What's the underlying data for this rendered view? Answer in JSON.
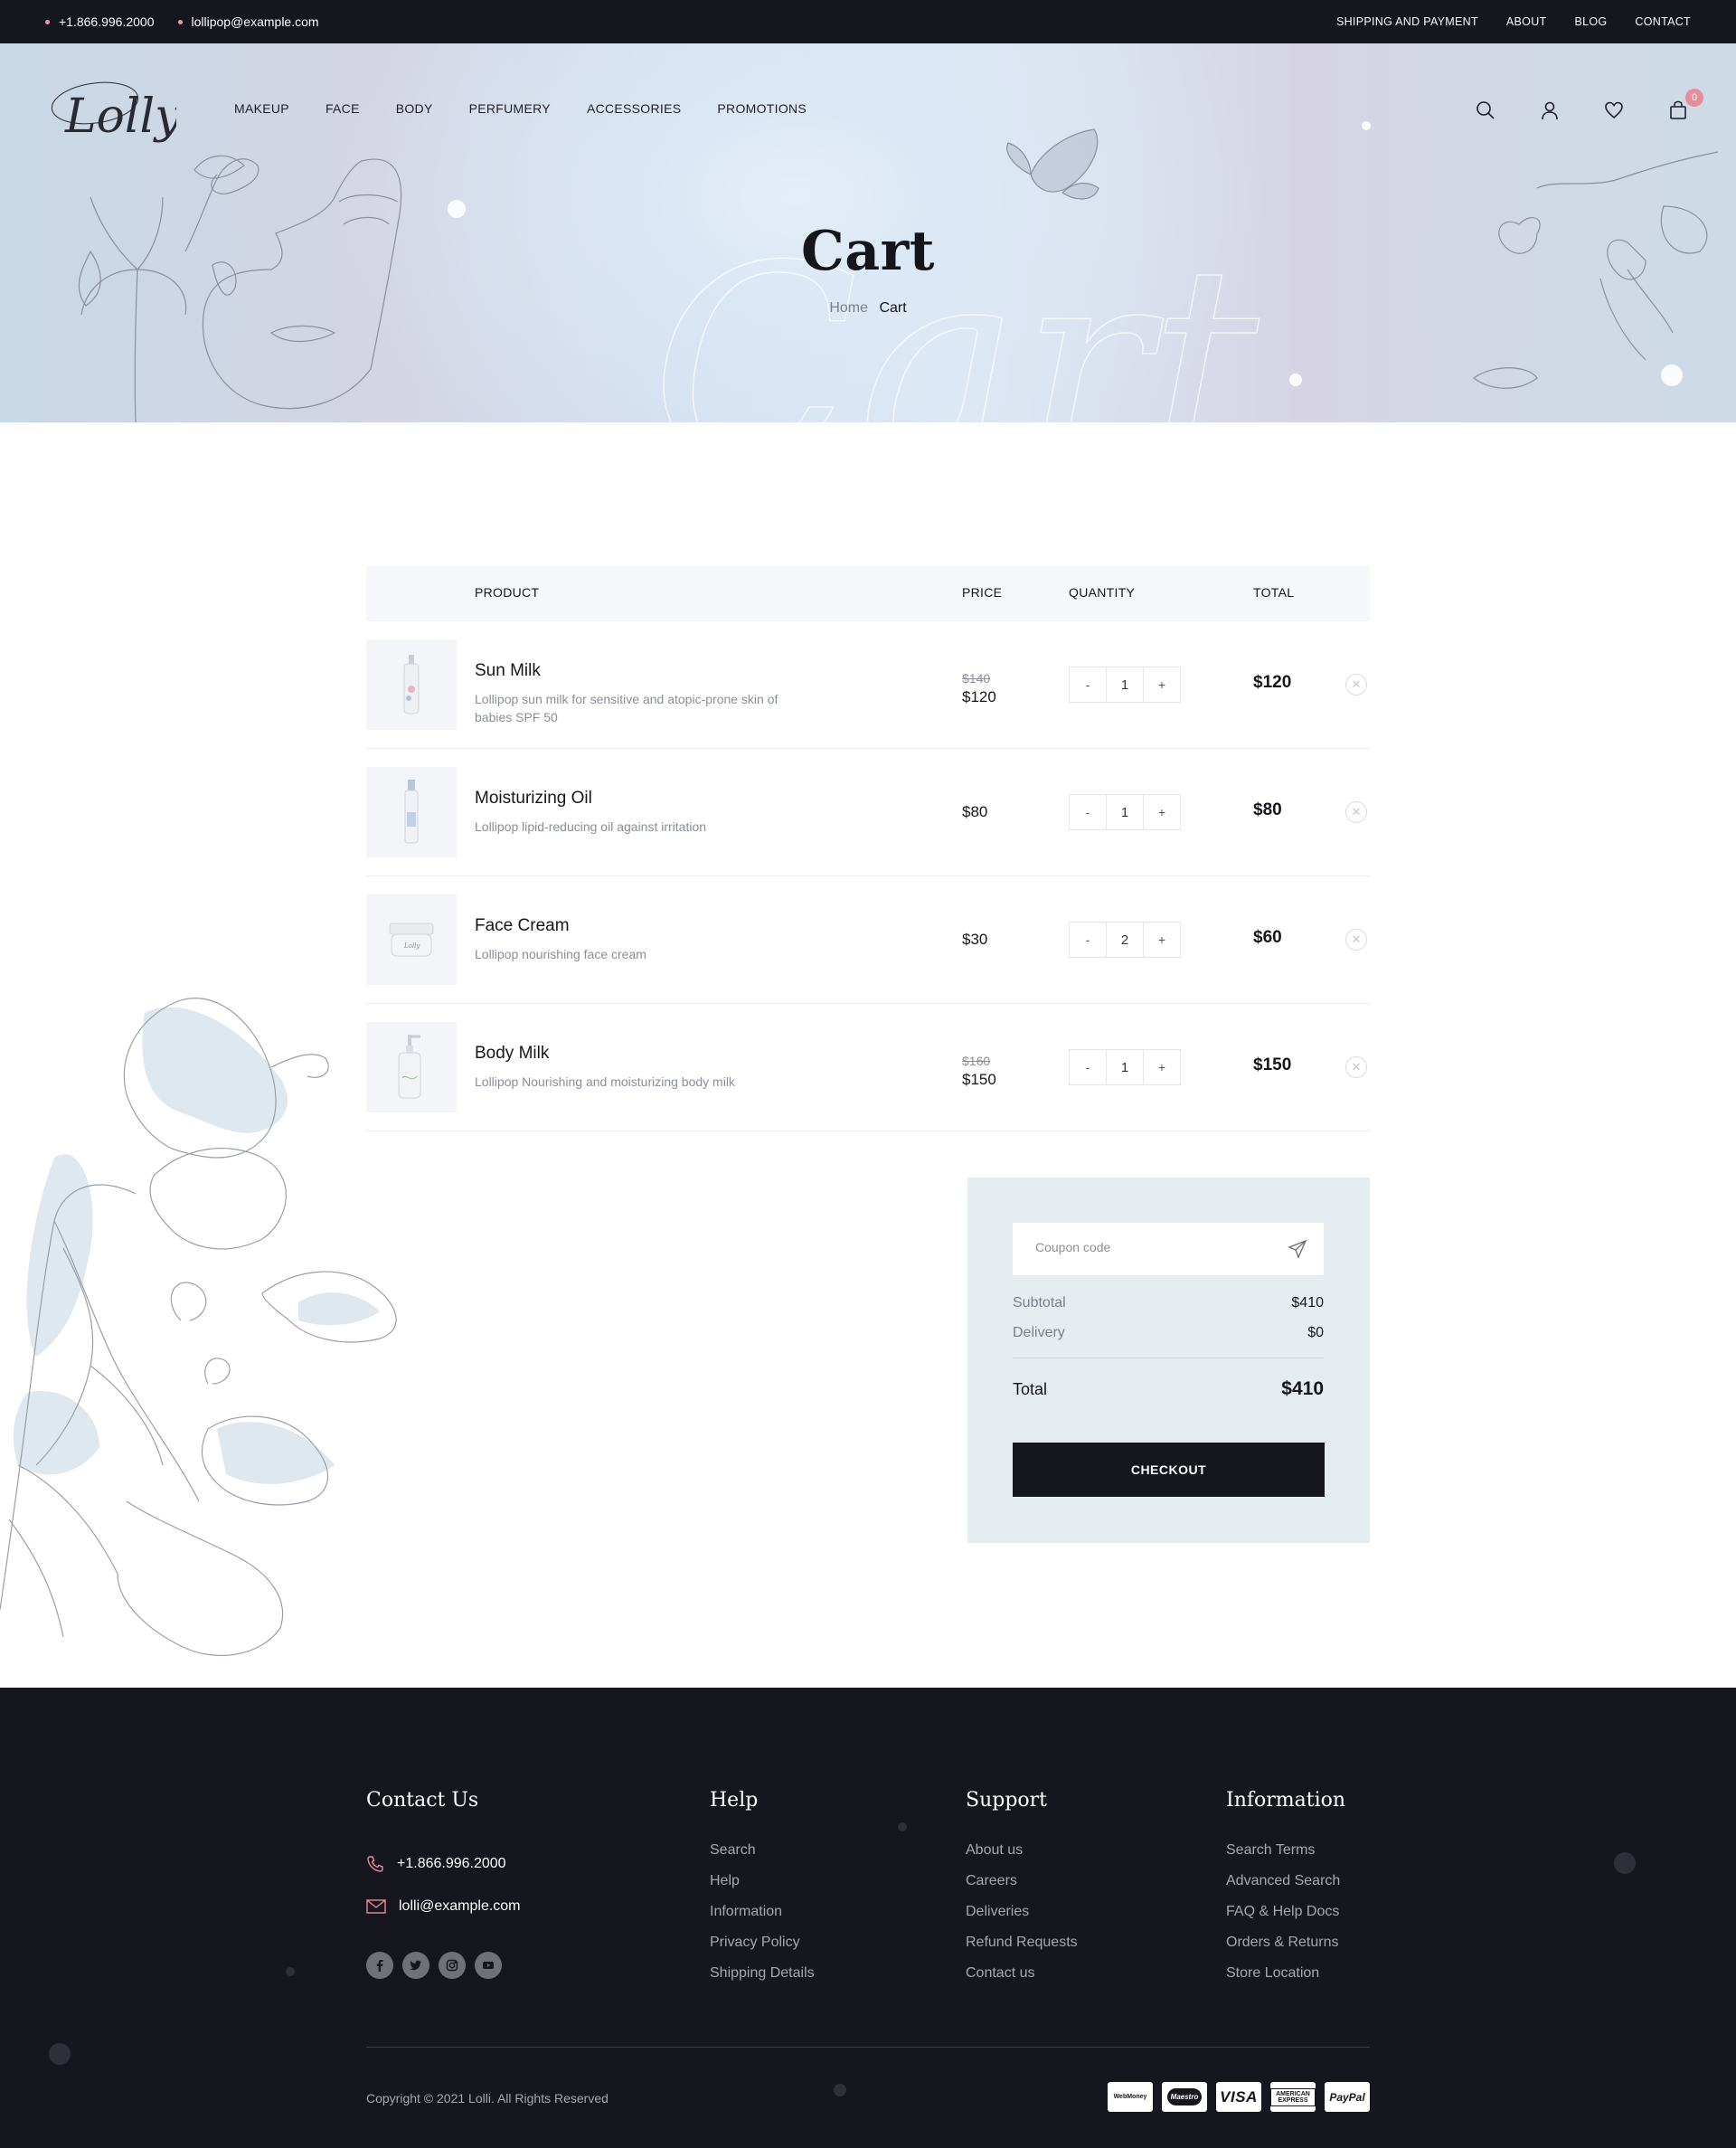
{
  "topbar": {
    "phone": "+1.866.996.2000",
    "email": "lollipop@example.com",
    "links": [
      "SHIPPING AND PAYMENT",
      "ABOUT",
      "BLOG",
      "CONTACT"
    ]
  },
  "header": {
    "logo_text": "Lolly",
    "nav": [
      "MAKEUP",
      "FACE",
      "BODY",
      "PERFUMERY",
      "ACCESSORIES",
      "PROMOTIONS"
    ],
    "icons": [
      "search-icon",
      "user-icon",
      "heart-icon",
      "bag-icon"
    ],
    "cart_count": "0"
  },
  "hero": {
    "title": "Cart",
    "watermark": "Cart",
    "breadcrumb": {
      "home": "Home",
      "current": "Cart"
    }
  },
  "cart": {
    "headers": {
      "product": "PRODUCT",
      "price": "PRICE",
      "quantity": "QUANTITY",
      "total": "TOTAL"
    },
    "items": [
      {
        "name": "Sun Milk",
        "description": "Lollipop sun milk for sensitive and atopic-prone skin of babies SPF 50",
        "old_price": "$140",
        "price": "$120",
        "qty": "1",
        "total": "$120"
      },
      {
        "name": "Moisturizing Oil",
        "description": "Lollipop lipid-reducing oil against irritation",
        "old_price": "",
        "price": "$80",
        "qty": "1",
        "total": "$80"
      },
      {
        "name": "Face Cream",
        "description": "Lollipop nourishing face cream",
        "old_price": "",
        "price": "$30",
        "qty": "2",
        "total": "$60"
      },
      {
        "name": "Body Milk",
        "description": "Lollipop Nourishing and moisturizing body milk",
        "old_price": "$160",
        "price": "$150",
        "qty": "1",
        "total": "$150"
      }
    ],
    "qty_minus": "-",
    "qty_plus": "+"
  },
  "summary": {
    "coupon_placeholder": "Coupon code",
    "subtotal_label": "Subtotal",
    "subtotal_value": "$410",
    "delivery_label": "Delivery",
    "delivery_value": "$0",
    "total_label": "Total",
    "total_value": "$410",
    "checkout_label": "CHECKOUT"
  },
  "footer": {
    "contact": {
      "title": "Contact Us",
      "phone": "+1.866.996.2000",
      "email": "lolli@example.com"
    },
    "help": {
      "title": "Help",
      "items": [
        "Search",
        "Help",
        "Information",
        "Privacy Policy",
        "Shipping Details"
      ]
    },
    "support": {
      "title": "Support",
      "items": [
        "About us",
        "Careers",
        "Deliveries",
        "Refund Requests",
        "Contact us"
      ]
    },
    "information": {
      "title": "Information",
      "items": [
        "Search Terms",
        "Advanced Search",
        "FAQ & Help Docs",
        "Orders & Returns",
        "Store Location"
      ]
    },
    "social": [
      "facebook-icon",
      "twitter-icon",
      "instagram-icon",
      "youtube-icon"
    ],
    "copyright": "Copyright © 2021 Lolli.  All Rights Reserved",
    "payments": [
      "WebMoney",
      "Maestro",
      "VISA",
      "AMERICAN EXPRESS",
      "PayPal"
    ]
  },
  "colors": {
    "dark": "#16161f",
    "accent_pink": "#e88c99",
    "summary_bg": "#e6edf1",
    "table_head_bg": "#f6f7fa"
  }
}
